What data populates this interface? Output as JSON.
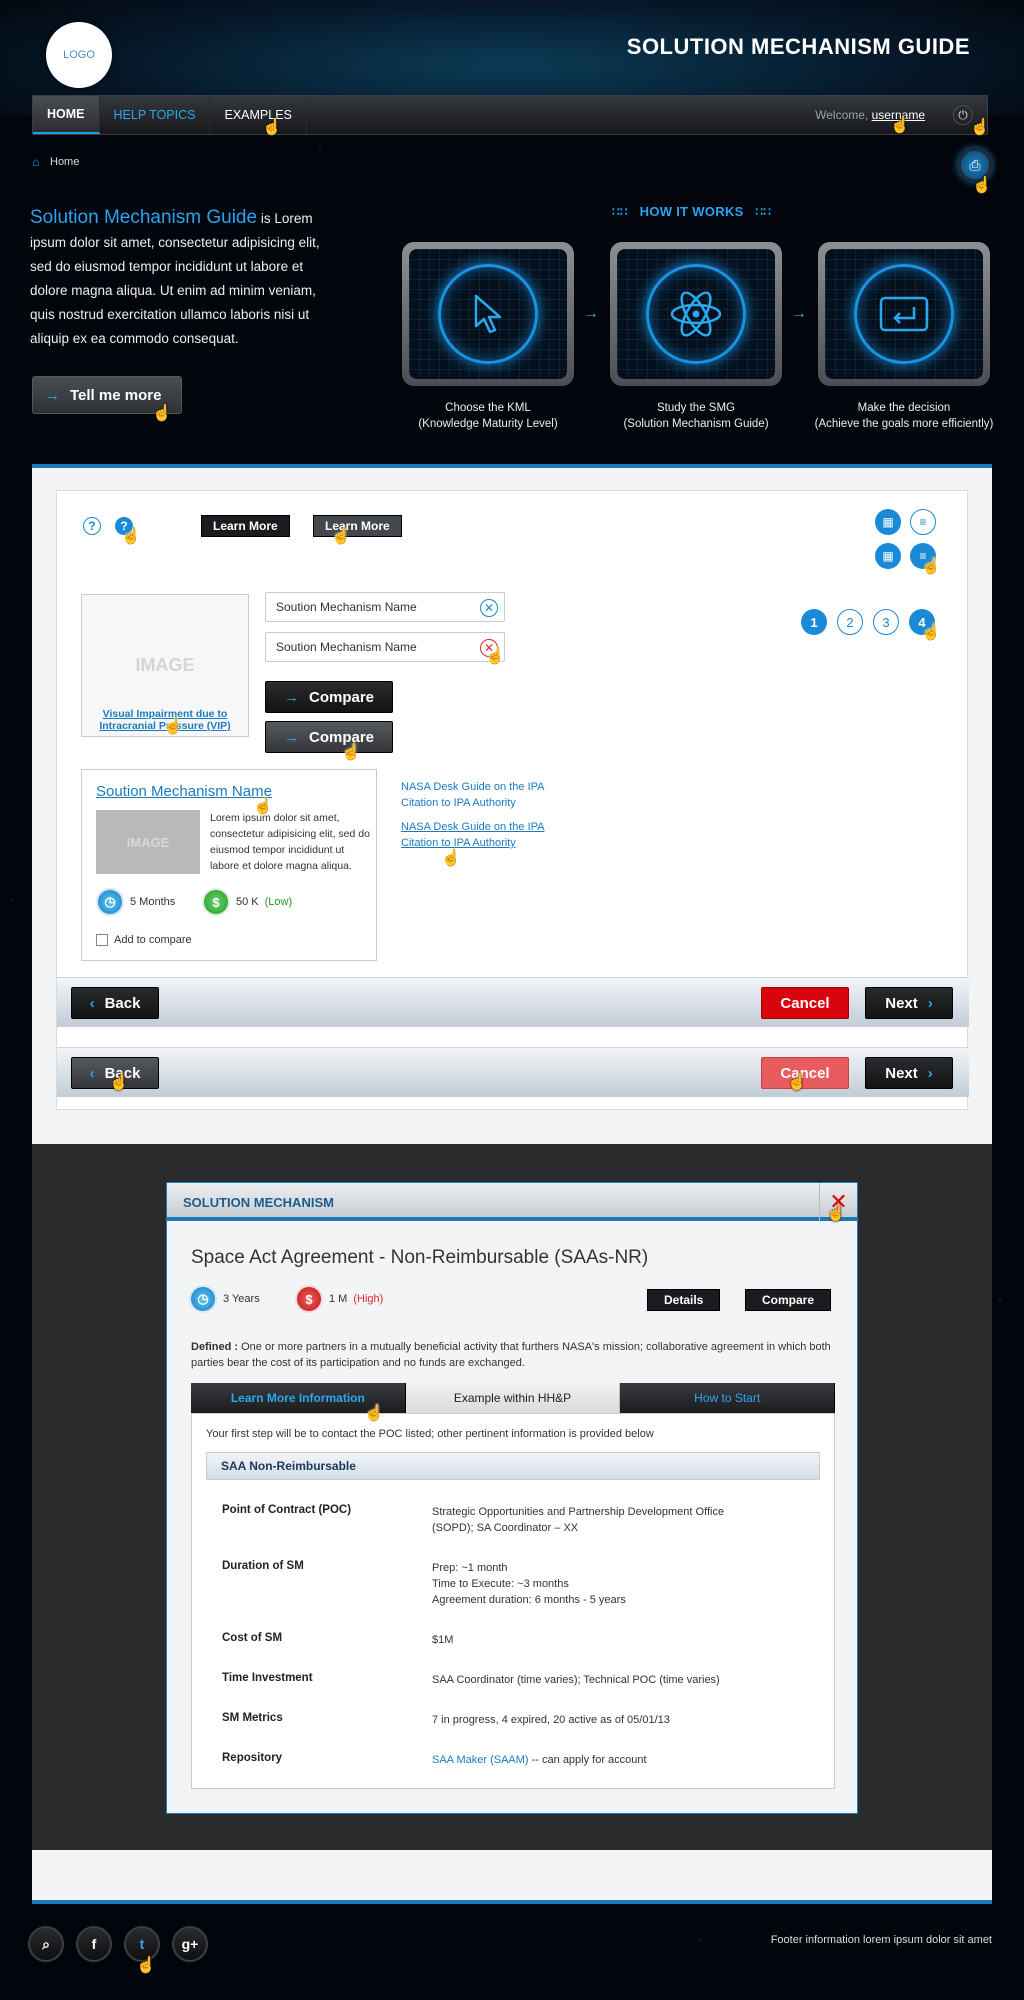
{
  "header": {
    "logo": "LOGO",
    "title": "SOLUTION MECHANISM GUIDE"
  },
  "nav": {
    "items": [
      {
        "label": "HOME"
      },
      {
        "label": "HELP TOPICS"
      },
      {
        "label": "EXAMPLES"
      }
    ],
    "welcome": "Welcome,",
    "username": "username"
  },
  "breadcrumb": {
    "home": "Home"
  },
  "intro": {
    "heading": "Solution Mechanism Guide",
    "text": "is Lorem ipsum dolor sit amet, consectetur adipisicing elit, sed do eiusmod tempor incididunt ut labore et dolore magna aliqua. Ut enim ad minim veniam, quis nostrud exercitation ullamco laboris nisi ut aliquip ex ea commodo consequat.",
    "button": "Tell me more"
  },
  "how_it_works": {
    "title": "HOW IT WORKS",
    "steps": [
      {
        "line1": "Choose the KML",
        "line2": "(Knowledge Maturity  Level)"
      },
      {
        "line1": "Study the SMG",
        "line2": "(Solution Mechanism Guide)"
      },
      {
        "line1": "Make the decision",
        "line2": "(Achieve the goals more efficiently)"
      }
    ]
  },
  "components": {
    "help_icon": "?",
    "learn_more_1": "Learn More",
    "learn_more_2": "Learn More",
    "pagination": [
      "1",
      "2",
      "3",
      "4"
    ],
    "image_box": {
      "placeholder": "IMAGE",
      "caption": "Visual Impairment due to Intracranial Pressure (VIP)"
    },
    "input_1": "Soution Mechanism Name",
    "input_2": "Soution Mechanism Name",
    "compare_1": "Compare",
    "compare_2": "Compare",
    "card": {
      "title": "Soution Mechanism Name",
      "image": "IMAGE",
      "text": "Lorem ipsum dolor sit amet, consectetur adipisicing elit, sed do eiusmod tempor incididunt ut labore et dolore magna aliqua.",
      "duration": "5 Months",
      "cost": "50 K",
      "cost_level": "(Low)",
      "add_to_compare": "Add to compare"
    },
    "links": [
      {
        "line1": "NASA Desk Guide on the IPA",
        "line2": "Citation to IPA Authority"
      },
      {
        "line1": "NASA Desk Guide on the IPA",
        "line2": "Citation to IPA Authority"
      }
    ],
    "footer_bar": {
      "back": "Back",
      "cancel": "Cancel",
      "next": "Next"
    }
  },
  "modal": {
    "header": "SOLUTION MECHANISM",
    "title": "Space Act Agreement - Non-Reimbursable (SAAs-NR)",
    "duration": "3 Years",
    "cost": "1 M",
    "cost_level": "(High)",
    "details_button": "Details",
    "compare_button": "Compare",
    "defined_label": "Defined :",
    "defined_text": "One or more partners in a mutually beneficial activity that furthers NASA's mission; collaborative agreement in which both parties bear the cost of its participation and no funds are exchanged.",
    "tabs": [
      {
        "label": "Learn More Information"
      },
      {
        "label": "Example within HH&P"
      },
      {
        "label": "How to Start"
      }
    ],
    "intro": "Your first step will be to contact the POC listed; other pertinent information is provided below",
    "section_title": "SAA Non-Reimbursable",
    "rows": [
      {
        "label": "Point of Contract (POC)",
        "value": [
          "Strategic Opportunities and Partnership Development Office",
          "(SOPD); SA Coordinator – XX"
        ]
      },
      {
        "label": "Duration of SM",
        "value": [
          "Prep: ~1 month",
          "Time to Execute: ~3 months",
          "Agreement duration: 6 months - 5 years"
        ]
      },
      {
        "label": "Cost of SM",
        "value": [
          "$1M"
        ]
      },
      {
        "label": "Time Investment",
        "value": [
          "SAA Coordinator (time varies); Technical POC (time varies)"
        ]
      },
      {
        "label": "SM Metrics",
        "value": [
          "7 in progress,  4 expired, 20 active as of 05/01/13"
        ]
      },
      {
        "label": "Repository",
        "link": "SAA Maker (SAAM)",
        "value": [
          "-- can apply for account"
        ]
      }
    ]
  },
  "footer": {
    "social": [
      {
        "icon": "rss-icon"
      },
      {
        "icon": "facebook-icon"
      },
      {
        "icon": "twitter-icon"
      },
      {
        "icon": "google-plus-icon"
      }
    ],
    "info": "Footer information lorem ipsum dolor sit amet"
  },
  "colors": {
    "accent": "#1a8ad6",
    "cancel": "#d9040c",
    "success": "#26992a",
    "danger": "#d82a2a"
  }
}
